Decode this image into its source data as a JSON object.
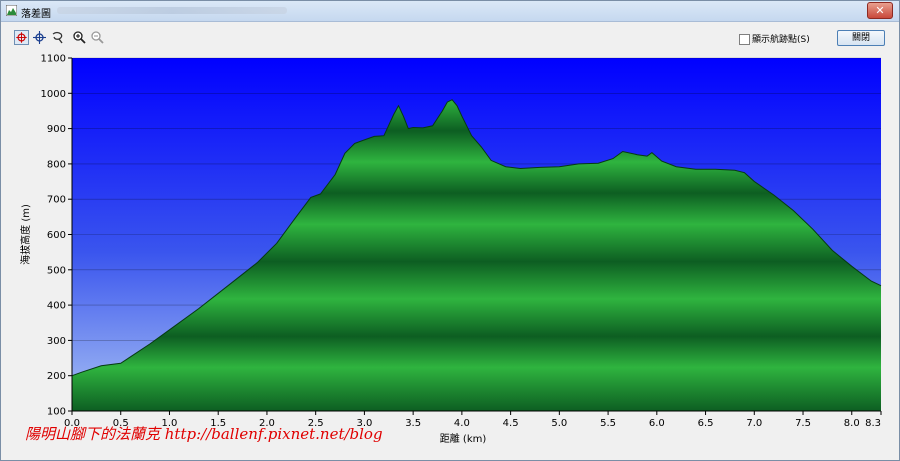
{
  "window": {
    "title": "落差圖",
    "close_glyph": "✕"
  },
  "toolbar": {
    "icons": [
      "crosshair-select-icon",
      "crosshair-icon",
      "lasso-icon",
      "zoom-in-icon",
      "zoom-out-icon"
    ],
    "show_trackpoints_label": "顯示航跡點(S)",
    "show_trackpoints_checked": false,
    "close_label": "關閉"
  },
  "watermark": "陽明山腳下的法蘭克 http://ballenf.pixnet.net/blog",
  "chart_data": {
    "type": "area",
    "title": "",
    "xlabel": "距離 (km)",
    "ylabel": "海拔高度 (m)",
    "xlim": [
      0,
      8.3
    ],
    "ylim": [
      100,
      1100
    ],
    "x_ticks": [
      0.0,
      0.5,
      1.0,
      1.5,
      2.0,
      2.5,
      3.0,
      3.5,
      4.0,
      4.5,
      5.0,
      5.5,
      6.0,
      6.5,
      7.0,
      7.5,
      8.0,
      8.3
    ],
    "x_tick_labels": [
      "0.0",
      "0.5",
      "1.0",
      "1.5",
      "2.0",
      "2.5",
      "3.0",
      "3.5",
      "4.0",
      "4.5",
      "5.0",
      "5.5",
      "6.0",
      "6.5",
      "7.0",
      "7.5",
      "8.0",
      "8.3"
    ],
    "y_ticks": [
      100,
      200,
      300,
      400,
      500,
      600,
      700,
      800,
      900,
      1000,
      1100
    ],
    "y_tick_labels": [
      "100",
      "200",
      "300",
      "400",
      "500",
      "600",
      "700",
      "800",
      "900",
      "1000",
      "1100"
    ],
    "grid": true,
    "colors": {
      "sky_top": "#0000ff",
      "sky_bottom": "#a9c2f3",
      "fill_light": "#2fb43f",
      "fill_dark": "#0d5e22",
      "line": "#063a12"
    },
    "series": [
      {
        "x": [
          0.0,
          0.1,
          0.3,
          0.5,
          0.8,
          1.0,
          1.3,
          1.6,
          1.9,
          2.1,
          2.3,
          2.45,
          2.55,
          2.7,
          2.8,
          2.9,
          3.0,
          3.1,
          3.2,
          3.3,
          3.35,
          3.4,
          3.45,
          3.5,
          3.6,
          3.7,
          3.8,
          3.85,
          3.9,
          3.95,
          4.0,
          4.1,
          4.2,
          4.3,
          4.45,
          4.6,
          4.8,
          5.0,
          5.2,
          5.4,
          5.55,
          5.65,
          5.8,
          5.9,
          5.95,
          6.05,
          6.2,
          6.4,
          6.6,
          6.8,
          6.9,
          7.0,
          7.2,
          7.4,
          7.6,
          7.8,
          8.0,
          8.2,
          8.3
        ],
        "y": [
          200,
          210,
          228,
          235,
          290,
          330,
          390,
          455,
          520,
          575,
          650,
          705,
          715,
          770,
          830,
          858,
          868,
          878,
          880,
          940,
          965,
          935,
          900,
          903,
          902,
          908,
          950,
          975,
          982,
          965,
          935,
          880,
          848,
          810,
          792,
          787,
          790,
          792,
          800,
          802,
          815,
          835,
          826,
          822,
          832,
          808,
          792,
          785,
          785,
          782,
          775,
          750,
          712,
          668,
          615,
          555,
          510,
          468,
          455
        ]
      }
    ]
  }
}
